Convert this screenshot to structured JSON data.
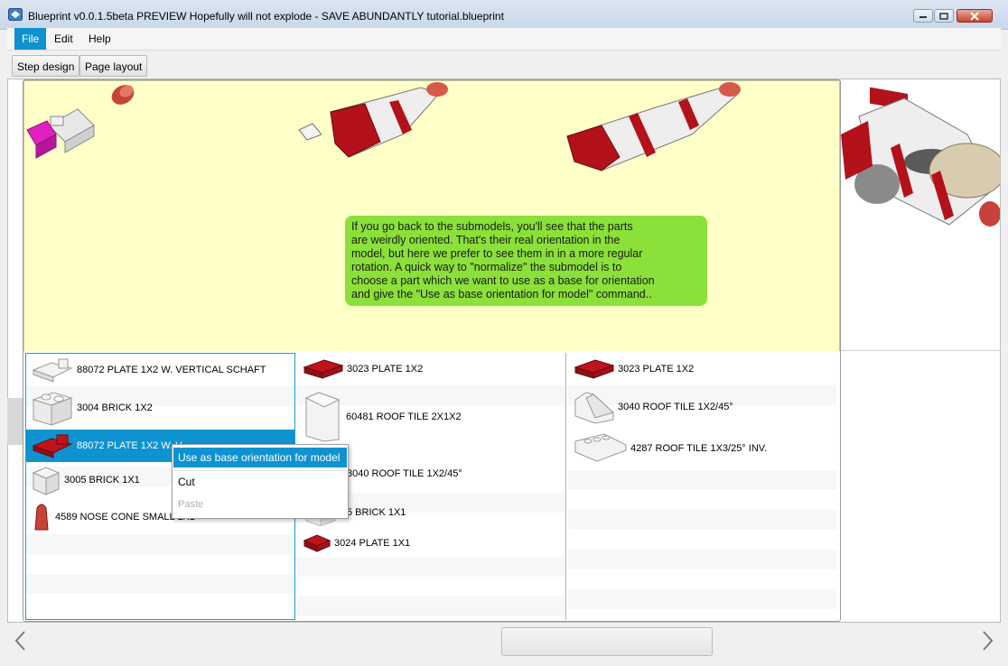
{
  "window": {
    "title": "Blueprint v0.0.1.5beta PREVIEW Hopefully will not explode - SAVE ABUNDANTLY  tutorial.blueprint",
    "buttons": [
      "minimize",
      "maximize",
      "close"
    ]
  },
  "menu": {
    "file": "File",
    "edit": "Edit",
    "help": "Help"
  },
  "tabs": {
    "step_design": "Step design",
    "page_layout": "Page layout"
  },
  "note": {
    "lines": [
      "If you go back to the submodels, you'll see that the parts",
      "are weirdly oriented. That's their real orientation in the",
      "model, but here we prefer to see them in in a more regular",
      "rotation. A quick way to \"normalize\" the submodel is to",
      "choose a part which we want to use as a base for orientation",
      "and give the \"Use as base orientation for model\" command.."
    ]
  },
  "parts": {
    "col1": [
      {
        "label": "88072 PLATE 1X2 W. VERTICAL SCHAFT",
        "icon": "plate-vertical-icon",
        "color": "white"
      },
      {
        "label": "3004 BRICK 1X2",
        "icon": "brick-icon",
        "color": "white"
      },
      {
        "label": "88072 PLATE 1X2 W. V",
        "icon": "plate-vertical-icon",
        "color": "red"
      },
      {
        "label": "3005 BRICK 1X1",
        "icon": "brick-icon",
        "color": "white"
      },
      {
        "label": "4589 NOSE CONE SMALL 1X1",
        "icon": "cone-icon",
        "color": "red"
      }
    ],
    "col2": [
      {
        "label": "3023 PLATE 1X2",
        "icon": "plate-icon",
        "color": "red"
      },
      {
        "label": "60481 ROOF TILE 2X1X2",
        "icon": "roof-tile-icon",
        "color": "white"
      },
      {
        "label": "3040 ROOF TILE 1X2/45°",
        "icon": "roof-tile-icon",
        "color": "white"
      },
      {
        "label": "5 BRICK 1X1",
        "icon": "brick-icon",
        "color": "white"
      },
      {
        "label": "3024 PLATE 1X1",
        "icon": "plate-icon",
        "color": "red"
      }
    ],
    "col3": [
      {
        "label": "3023 PLATE 1X2",
        "icon": "plate-icon",
        "color": "red"
      },
      {
        "label": "3040 ROOF TILE 1X2/45°",
        "icon": "roof-tile-icon",
        "color": "white"
      },
      {
        "label": "4287 ROOF TILE 1X3/25° INV.",
        "icon": "roof-tile-inv-icon",
        "color": "white"
      }
    ]
  },
  "context_menu": {
    "use_as_base": "Use as base orientation for model",
    "cut": "Cut",
    "paste": "Paste"
  },
  "colors": {
    "accent": "#0e93d0",
    "note_bg": "#8be03a",
    "canvas_bg": "#ffffc8",
    "brick_red": "#b3121b",
    "magenta": "#e020c0"
  }
}
